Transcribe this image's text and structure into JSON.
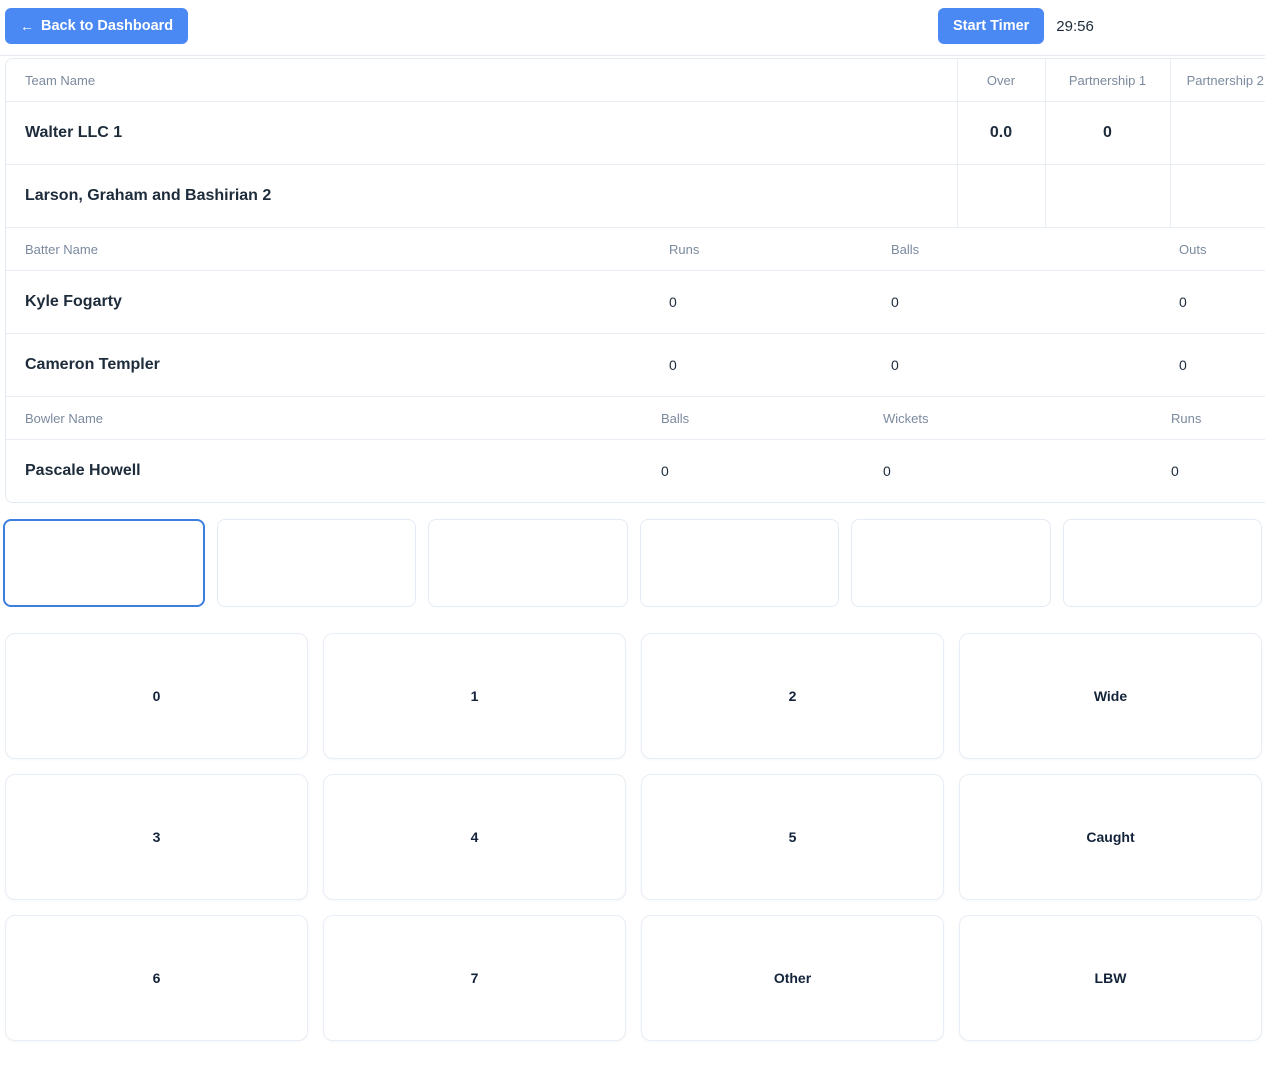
{
  "header": {
    "back_label": "Back to Dashboard",
    "back_arrow": "←",
    "start_timer_label": "Start Timer",
    "timer_value": "29:56",
    "accent_color": "#4a89f3"
  },
  "team_table": {
    "columns": [
      "Team Name",
      "Over",
      "Partnership 1",
      "Partnership 2"
    ],
    "rows": [
      {
        "name": "Walter LLC 1",
        "over": "0.0",
        "partnership_1": "0",
        "partnership_2": ""
      },
      {
        "name": "Larson, Graham and Bashirian 2",
        "over": "",
        "partnership_1": "",
        "partnership_2": ""
      }
    ]
  },
  "batter_table": {
    "columns": [
      "Batter Name",
      "Runs",
      "Balls",
      "Outs"
    ],
    "rows": [
      {
        "name": "Kyle Fogarty",
        "runs": "0",
        "balls": "0",
        "outs": "0"
      },
      {
        "name": "Cameron Templer",
        "runs": "0",
        "balls": "0",
        "outs": "0"
      }
    ]
  },
  "bowler_table": {
    "columns": [
      "Bowler Name",
      "Balls",
      "Wickets",
      "Runs"
    ],
    "rows": [
      {
        "name": "Pascale Howell",
        "balls": "0",
        "wickets": "0",
        "runs": "0"
      }
    ]
  },
  "ball_boxes": [
    {
      "label": "",
      "active": true
    },
    {
      "label": "",
      "active": false
    },
    {
      "label": "",
      "active": false
    },
    {
      "label": "",
      "active": false
    },
    {
      "label": "",
      "active": false
    },
    {
      "label": "",
      "active": false
    }
  ],
  "score_buttons": [
    "0",
    "1",
    "2",
    "Wide",
    "3",
    "4",
    "5",
    "Caught",
    "6",
    "7",
    "Other",
    "LBW"
  ]
}
